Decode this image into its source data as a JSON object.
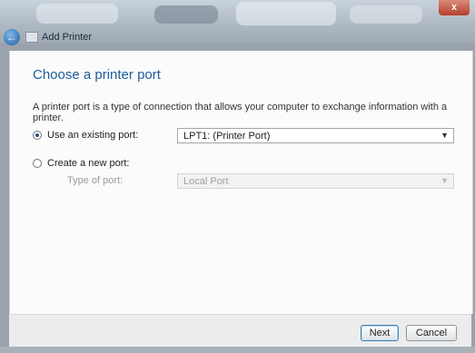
{
  "window": {
    "title": "Add Printer",
    "close_glyph": "x"
  },
  "nav": {
    "back_glyph": "←"
  },
  "page": {
    "heading": "Choose a printer port",
    "description": "A printer port is a type of connection that allows your computer to exchange information with a printer."
  },
  "options": {
    "existing": {
      "label": "Use an existing port:",
      "selected": true,
      "value": "LPT1: (Printer Port)"
    },
    "new": {
      "label": "Create a new port:",
      "selected": false,
      "type_label": "Type of port:",
      "value": "Local Port"
    }
  },
  "footer": {
    "next_label": "Next",
    "cancel_label": "Cancel"
  },
  "colors": {
    "heading": "#1f5d9b",
    "close": "#b5402a"
  },
  "icons": {
    "back": "back-arrow-icon",
    "dropdown": "chevron-down-icon",
    "printer": "printer-icon"
  }
}
